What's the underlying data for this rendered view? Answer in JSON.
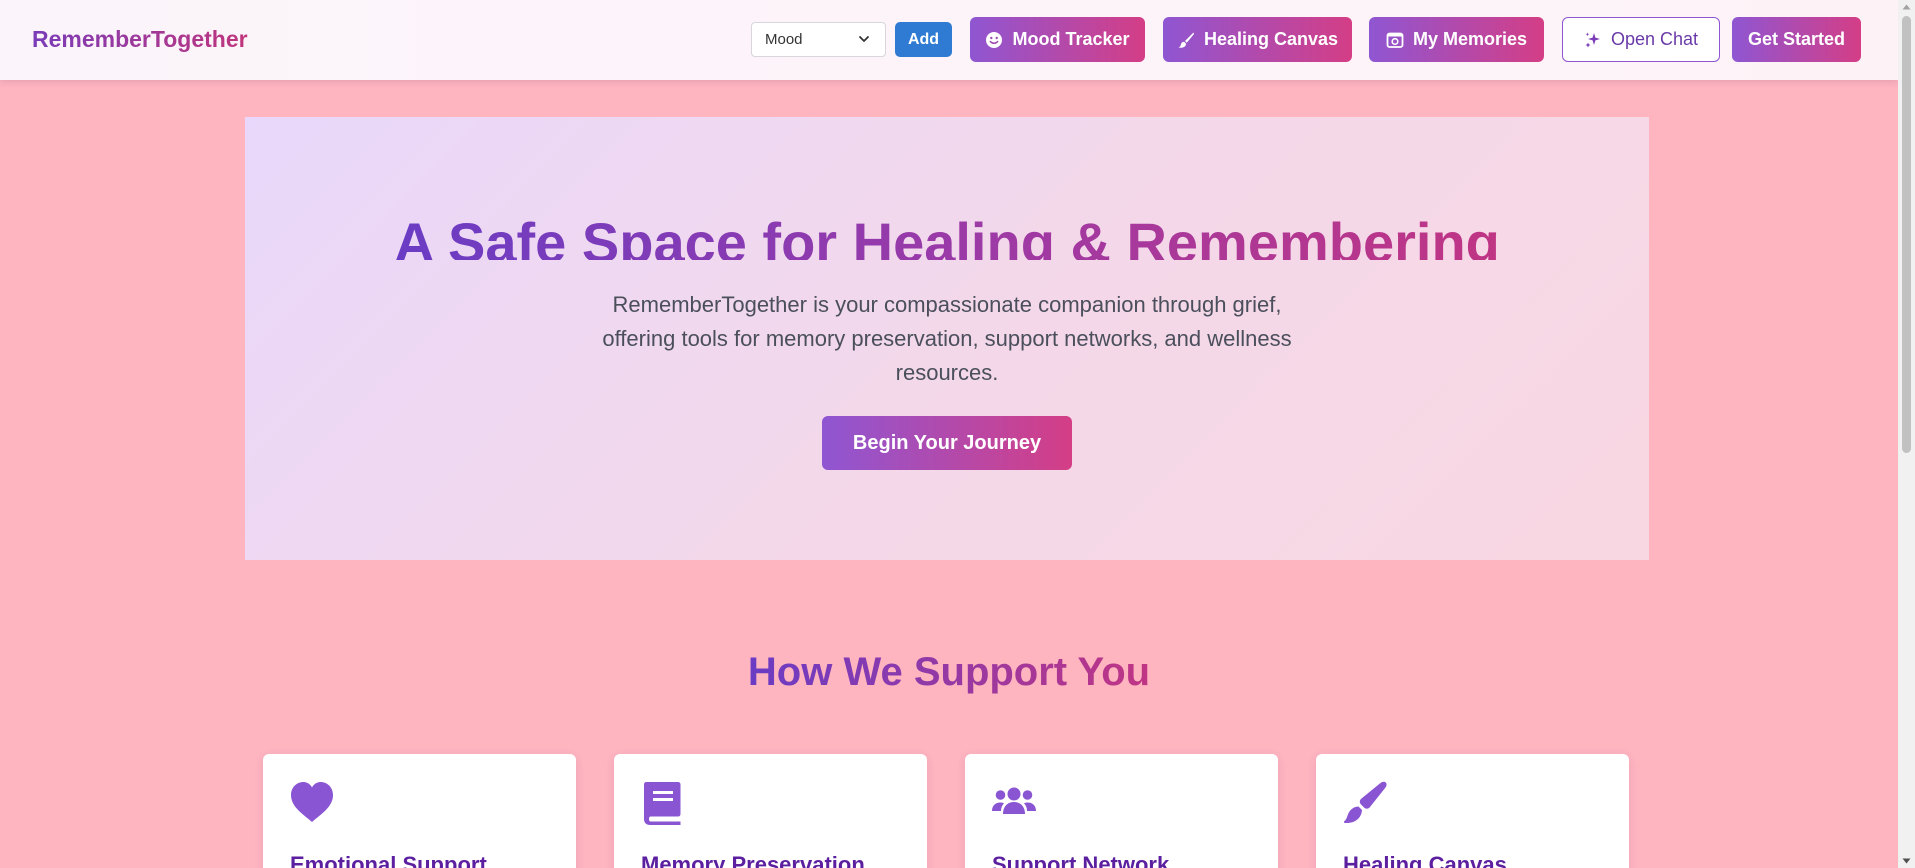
{
  "header": {
    "logo": "RememberTogether",
    "mood_select": {
      "value": "Mood"
    },
    "add_label": "Add",
    "nav": {
      "mood_tracker": "Mood Tracker",
      "healing_canvas": "Healing Canvas",
      "my_memories": "My Memories",
      "open_chat": "Open Chat",
      "get_started": "Get Started"
    }
  },
  "hero": {
    "title": "A Safe Space for Healing & Remembering",
    "description": "RememberTogether is your compassionate companion through grief, offering tools for memory preservation, support networks, and wellness resources.",
    "cta": "Begin Your Journey"
  },
  "support": {
    "title": "How We Support You",
    "cards": [
      {
        "title": "Emotional Support",
        "icon": "heart-icon"
      },
      {
        "title": "Memory Preservation",
        "icon": "book-icon"
      },
      {
        "title": "Support Network",
        "icon": "users-icon"
      },
      {
        "title": "Healing Canvas",
        "icon": "paintbrush-icon"
      }
    ]
  },
  "colors": {
    "page_background": "#feb5c0",
    "accent_purple": "#8f56d2",
    "accent_pink": "#d43e86",
    "add_button": "#2f7bd3",
    "card_title": "#5b1fa0",
    "icon_purple": "#8a55d3"
  }
}
